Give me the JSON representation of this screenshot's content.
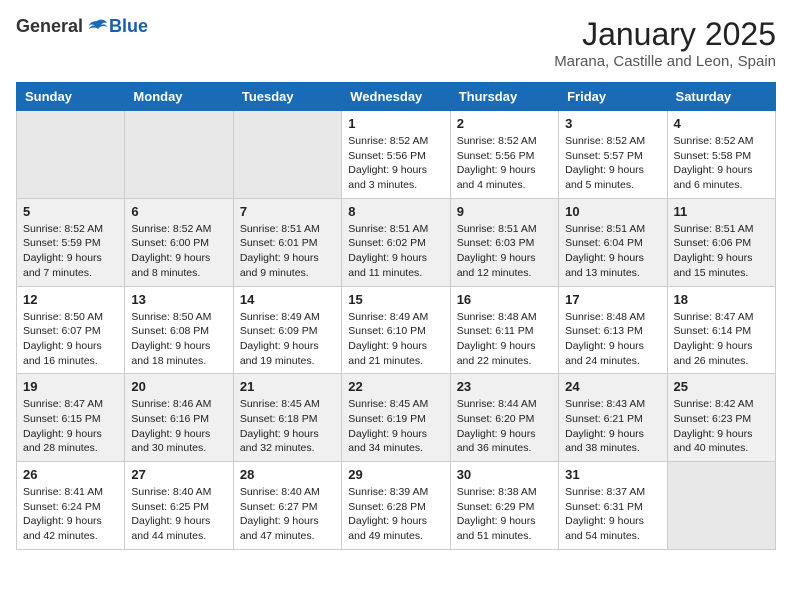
{
  "logo": {
    "general": "General",
    "blue": "Blue"
  },
  "title": "January 2025",
  "location": "Marana, Castille and Leon, Spain",
  "days_of_week": [
    "Sunday",
    "Monday",
    "Tuesday",
    "Wednesday",
    "Thursday",
    "Friday",
    "Saturday"
  ],
  "weeks": [
    [
      {
        "day": "",
        "info": ""
      },
      {
        "day": "",
        "info": ""
      },
      {
        "day": "",
        "info": ""
      },
      {
        "day": "1",
        "info": "Sunrise: 8:52 AM\nSunset: 5:56 PM\nDaylight: 9 hours and 3 minutes."
      },
      {
        "day": "2",
        "info": "Sunrise: 8:52 AM\nSunset: 5:56 PM\nDaylight: 9 hours and 4 minutes."
      },
      {
        "day": "3",
        "info": "Sunrise: 8:52 AM\nSunset: 5:57 PM\nDaylight: 9 hours and 5 minutes."
      },
      {
        "day": "4",
        "info": "Sunrise: 8:52 AM\nSunset: 5:58 PM\nDaylight: 9 hours and 6 minutes."
      }
    ],
    [
      {
        "day": "5",
        "info": "Sunrise: 8:52 AM\nSunset: 5:59 PM\nDaylight: 9 hours and 7 minutes."
      },
      {
        "day": "6",
        "info": "Sunrise: 8:52 AM\nSunset: 6:00 PM\nDaylight: 9 hours and 8 minutes."
      },
      {
        "day": "7",
        "info": "Sunrise: 8:51 AM\nSunset: 6:01 PM\nDaylight: 9 hours and 9 minutes."
      },
      {
        "day": "8",
        "info": "Sunrise: 8:51 AM\nSunset: 6:02 PM\nDaylight: 9 hours and 11 minutes."
      },
      {
        "day": "9",
        "info": "Sunrise: 8:51 AM\nSunset: 6:03 PM\nDaylight: 9 hours and 12 minutes."
      },
      {
        "day": "10",
        "info": "Sunrise: 8:51 AM\nSunset: 6:04 PM\nDaylight: 9 hours and 13 minutes."
      },
      {
        "day": "11",
        "info": "Sunrise: 8:51 AM\nSunset: 6:06 PM\nDaylight: 9 hours and 15 minutes."
      }
    ],
    [
      {
        "day": "12",
        "info": "Sunrise: 8:50 AM\nSunset: 6:07 PM\nDaylight: 9 hours and 16 minutes."
      },
      {
        "day": "13",
        "info": "Sunrise: 8:50 AM\nSunset: 6:08 PM\nDaylight: 9 hours and 18 minutes."
      },
      {
        "day": "14",
        "info": "Sunrise: 8:49 AM\nSunset: 6:09 PM\nDaylight: 9 hours and 19 minutes."
      },
      {
        "day": "15",
        "info": "Sunrise: 8:49 AM\nSunset: 6:10 PM\nDaylight: 9 hours and 21 minutes."
      },
      {
        "day": "16",
        "info": "Sunrise: 8:48 AM\nSunset: 6:11 PM\nDaylight: 9 hours and 22 minutes."
      },
      {
        "day": "17",
        "info": "Sunrise: 8:48 AM\nSunset: 6:13 PM\nDaylight: 9 hours and 24 minutes."
      },
      {
        "day": "18",
        "info": "Sunrise: 8:47 AM\nSunset: 6:14 PM\nDaylight: 9 hours and 26 minutes."
      }
    ],
    [
      {
        "day": "19",
        "info": "Sunrise: 8:47 AM\nSunset: 6:15 PM\nDaylight: 9 hours and 28 minutes."
      },
      {
        "day": "20",
        "info": "Sunrise: 8:46 AM\nSunset: 6:16 PM\nDaylight: 9 hours and 30 minutes."
      },
      {
        "day": "21",
        "info": "Sunrise: 8:45 AM\nSunset: 6:18 PM\nDaylight: 9 hours and 32 minutes."
      },
      {
        "day": "22",
        "info": "Sunrise: 8:45 AM\nSunset: 6:19 PM\nDaylight: 9 hours and 34 minutes."
      },
      {
        "day": "23",
        "info": "Sunrise: 8:44 AM\nSunset: 6:20 PM\nDaylight: 9 hours and 36 minutes."
      },
      {
        "day": "24",
        "info": "Sunrise: 8:43 AM\nSunset: 6:21 PM\nDaylight: 9 hours and 38 minutes."
      },
      {
        "day": "25",
        "info": "Sunrise: 8:42 AM\nSunset: 6:23 PM\nDaylight: 9 hours and 40 minutes."
      }
    ],
    [
      {
        "day": "26",
        "info": "Sunrise: 8:41 AM\nSunset: 6:24 PM\nDaylight: 9 hours and 42 minutes."
      },
      {
        "day": "27",
        "info": "Sunrise: 8:40 AM\nSunset: 6:25 PM\nDaylight: 9 hours and 44 minutes."
      },
      {
        "day": "28",
        "info": "Sunrise: 8:40 AM\nSunset: 6:27 PM\nDaylight: 9 hours and 47 minutes."
      },
      {
        "day": "29",
        "info": "Sunrise: 8:39 AM\nSunset: 6:28 PM\nDaylight: 9 hours and 49 minutes."
      },
      {
        "day": "30",
        "info": "Sunrise: 8:38 AM\nSunset: 6:29 PM\nDaylight: 9 hours and 51 minutes."
      },
      {
        "day": "31",
        "info": "Sunrise: 8:37 AM\nSunset: 6:31 PM\nDaylight: 9 hours and 54 minutes."
      },
      {
        "day": "",
        "info": ""
      }
    ]
  ]
}
